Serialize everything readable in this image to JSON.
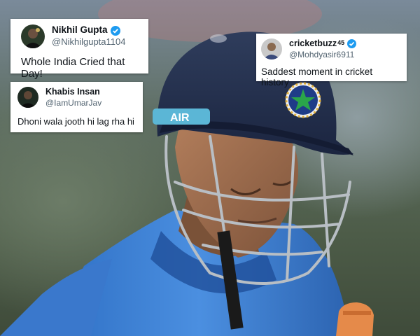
{
  "tweets": [
    {
      "name": "Nikhil Gupta",
      "handle": "@Nikhilgupta1104",
      "verified": true,
      "text": "Whole India Cried that Day!",
      "avatar_icon": "dark-portrait-avatar"
    },
    {
      "name": "cricketbuzz",
      "name_superscript": "45",
      "handle": "@Mohdyasir6911",
      "verified": true,
      "text": "Saddest moment in cricket history",
      "avatar_icon": "portrait-avatar"
    },
    {
      "name": "Khabis Insan",
      "handle": "@IamUmarJav",
      "verified": false,
      "text": "Dhoni wala jooth hi lag rha hi",
      "avatar_icon": "dark-portrait-avatar"
    }
  ],
  "photo": {
    "helmet_label": "AIR",
    "subject": "cricketer-in-helmet"
  },
  "colors": {
    "verified_blue": "#1d9bf0",
    "handle_gray": "#536471",
    "helmet_navy": "#1f2a44",
    "jersey_blue": "#3f82d6"
  }
}
